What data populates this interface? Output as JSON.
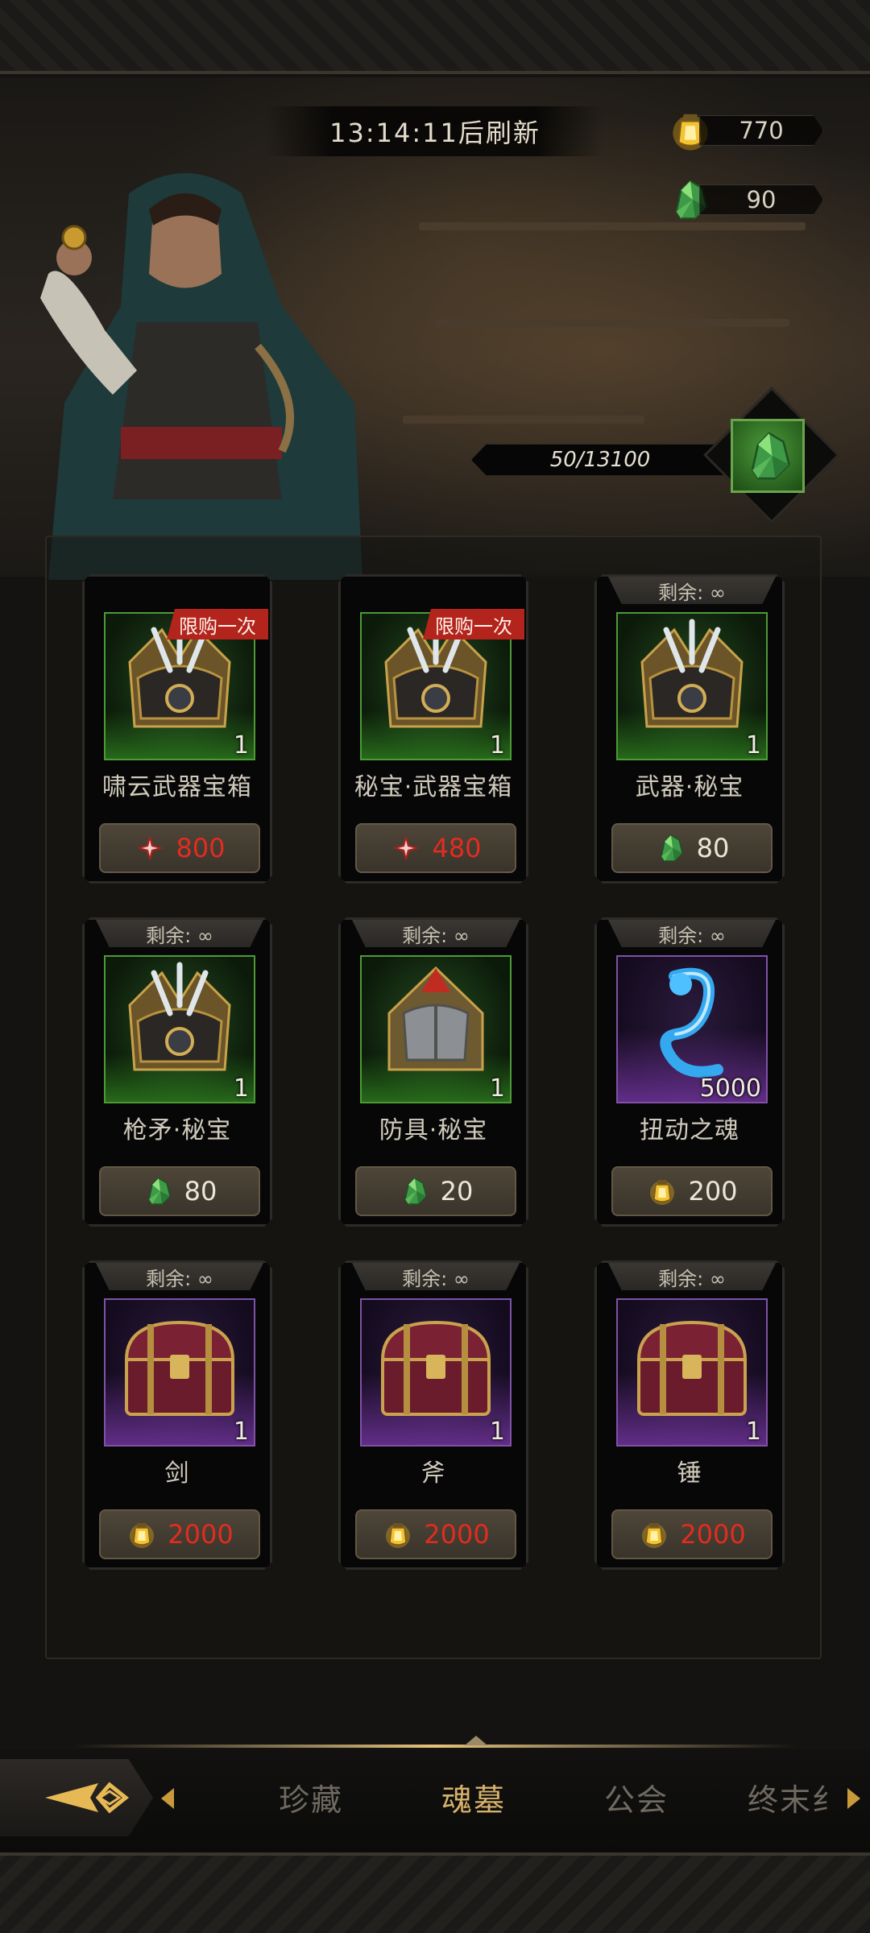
{
  "header": {
    "refresh_timer": "13:14:11后刷新"
  },
  "currencies": [
    {
      "icon": "gold-lantern-icon",
      "value": "770"
    },
    {
      "icon": "green-crystal-icon",
      "value": "90"
    }
  ],
  "progress": {
    "text": "50/13100",
    "icon": "green-crystal-icon"
  },
  "items": [
    {
      "name": "啸云武器宝箱",
      "quantity": "1",
      "limit_label": "限购一次",
      "remain": "",
      "rarity": "green",
      "art": "weapon-chest-icon",
      "price": "800",
      "price_icon": "red-shard-icon",
      "price_red": true
    },
    {
      "name": "秘宝·武器宝箱",
      "quantity": "1",
      "limit_label": "限购一次",
      "remain": "",
      "rarity": "green",
      "art": "weapon-chest-icon",
      "price": "480",
      "price_icon": "red-shard-icon",
      "price_red": true
    },
    {
      "name": "武器·秘宝",
      "quantity": "1",
      "limit_label": "",
      "remain": "剩余: ∞",
      "rarity": "green",
      "art": "weapon-chest-icon",
      "price": "80",
      "price_icon": "green-crystal-icon",
      "price_red": false
    },
    {
      "name": "枪矛·秘宝",
      "quantity": "1",
      "limit_label": "",
      "remain": "剩余: ∞",
      "rarity": "green",
      "art": "weapon-chest-icon",
      "price": "80",
      "price_icon": "green-crystal-icon",
      "price_red": false
    },
    {
      "name": "防具·秘宝",
      "quantity": "1",
      "limit_label": "",
      "remain": "剩余: ∞",
      "rarity": "green",
      "art": "armor-chest-icon",
      "price": "20",
      "price_icon": "green-crystal-icon",
      "price_red": false
    },
    {
      "name": "扭动之魂",
      "quantity": "5000",
      "limit_label": "",
      "remain": "剩余: ∞",
      "rarity": "purple",
      "art": "twisting-soul-icon",
      "price": "200",
      "price_icon": "gold-lantern-icon",
      "price_red": false
    },
    {
      "name": "剑",
      "quantity": "1",
      "limit_label": "",
      "remain": "剩余: ∞",
      "rarity": "purple",
      "art": "treasure-chest-icon",
      "price": "2000",
      "price_icon": "gold-lantern-icon",
      "price_red": true
    },
    {
      "name": "斧",
      "quantity": "1",
      "limit_label": "",
      "remain": "剩余: ∞",
      "rarity": "purple",
      "art": "treasure-chest-icon",
      "price": "2000",
      "price_icon": "gold-lantern-icon",
      "price_red": true
    },
    {
      "name": "锤",
      "quantity": "1",
      "limit_label": "",
      "remain": "剩余: ∞",
      "rarity": "purple",
      "art": "treasure-chest-icon",
      "price": "2000",
      "price_icon": "gold-lantern-icon",
      "price_red": true
    }
  ],
  "nav": {
    "back_icon": "back-arrow-icon",
    "tabs": [
      {
        "label": "珍藏",
        "active": false
      },
      {
        "label": "魂墓",
        "active": true
      },
      {
        "label": "公会",
        "active": false
      },
      {
        "label": "终末纟",
        "active": false
      }
    ]
  },
  "colors": {
    "accent_gold": "#d7b26a",
    "price_red": "#e32b22",
    "limit_red": "#b3241c",
    "rarity_green": "#4d9a36",
    "rarity_purple": "#7f52a6"
  }
}
